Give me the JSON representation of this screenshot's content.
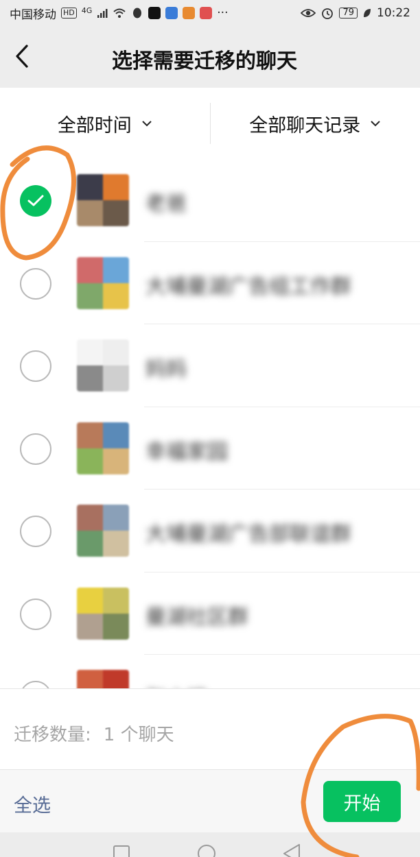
{
  "status_bar": {
    "carrier": "中国移动",
    "hd": "HD",
    "network": "4G",
    "battery": "79",
    "time": "10:22"
  },
  "header": {
    "title": "选择需要迁移的聊天"
  },
  "filters": {
    "time": "全部时间",
    "records": "全部聊天记录"
  },
  "chats": [
    {
      "name": "老爸",
      "selected": true,
      "avatar_colors": [
        "#e07a2e",
        "#6b5a4a",
        "#a88a6a",
        "#3c3c4a"
      ]
    },
    {
      "name": "大埔曼湖广告组工作群",
      "selected": false,
      "avatar_colors": [
        "#6aa6d8",
        "#e7c34a",
        "#7fa86a",
        "#d06a6a"
      ]
    },
    {
      "name": "妈妈",
      "selected": false,
      "avatar_colors": [
        "#eeeeee",
        "#cfcfcf",
        "#8a8a8a",
        "#f4f4f4"
      ]
    },
    {
      "name": "幸福家园",
      "selected": false,
      "avatar_colors": [
        "#5a8ab8",
        "#d8b47a",
        "#8ab45a",
        "#b87a5a"
      ]
    },
    {
      "name": "大埔曼湖广告部联谊群",
      "selected": false,
      "avatar_colors": [
        "#8aa0b8",
        "#d0c0a0",
        "#6a9a6a",
        "#a87060"
      ]
    },
    {
      "name": "曼湖社区群",
      "selected": false,
      "avatar_colors": [
        "#c9c060",
        "#7a8a5a",
        "#b0a090",
        "#e8d040"
      ]
    },
    {
      "name": "张小姐",
      "selected": false,
      "avatar_colors": [
        "#c03a2a",
        "#e0a040",
        "#7a5030",
        "#d06040"
      ]
    }
  ],
  "summary": {
    "label": "迁移数量:",
    "value": "1 个聊天"
  },
  "actions": {
    "select_all": "全选",
    "start": "开始"
  },
  "colors": {
    "accent": "#07c160",
    "link": "#576b95",
    "annotation": "#ef8c3c"
  }
}
